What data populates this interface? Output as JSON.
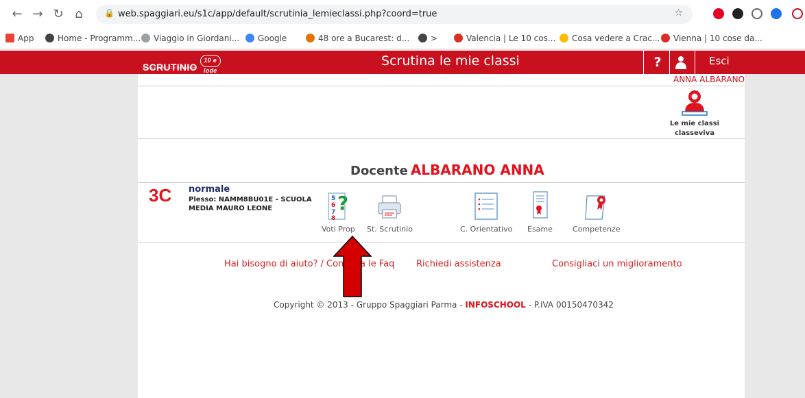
{
  "browser": {
    "url": "web.spaggiari.eu/s1c/app/default/scrutinia_lemieclassi.php?coord=true",
    "bookmarks": [
      "App",
      "Home - Programm...",
      "Viaggio in Giordani...",
      "Google",
      "48 ore a Bucarest: d...",
      ">",
      "Valencia | Le 10 cos...",
      "Cosa vedere a Crac...",
      "Vienna | 10 cose da..."
    ]
  },
  "header": {
    "logo": "SCRUTINIO",
    "logo_sub": "SPECIALE PRIMO CICLO DI ISTRUZIONE",
    "logo_badge": "10 e lode",
    "title": "Scrutina le mie classi",
    "help": "?",
    "logout": "Esci"
  },
  "user": {
    "name": "ANNA ALBARANO",
    "my_classes_line1": "Le mie classi",
    "my_classes_line2": "classeviva"
  },
  "teacher": {
    "label": "Docente",
    "name": "ALBARANO ANNA"
  },
  "class": {
    "code": "3C",
    "type": "normale",
    "plesso": "Plesso: NAMM8BU01E - SCUOLA MEDIA MAURO LEONE"
  },
  "actions": [
    "Voti Prop",
    "St. Scrutinio",
    "C. Orientativo",
    "Esame",
    "Competenze"
  ],
  "help_links": [
    "Hai bisogno di aiuto? / Consulta le Faq",
    "Richiedi assistenza",
    "Consigliaci un miglioramento"
  ],
  "footer": {
    "prefix": "Copyright © 2013 - Gruppo Spaggiari Parma - ",
    "brand": "INFOSCHOOL",
    "suffix": " - P.IVA 00150470342"
  },
  "colors": {
    "brand_red": "#c8101e",
    "accent_red": "#e0131e",
    "annotation_arrow": "#d40000"
  }
}
